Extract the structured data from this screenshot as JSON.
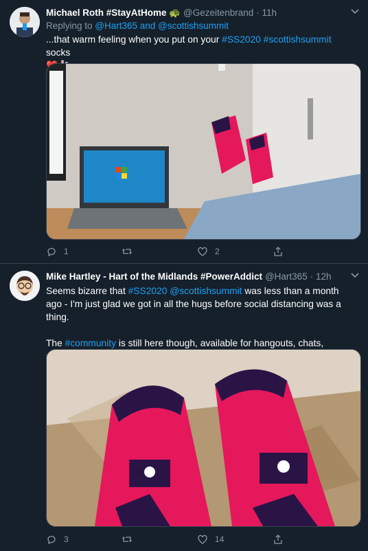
{
  "tweets": [
    {
      "name": "Michael Roth #StayAtHome 🐢",
      "handle": "@Gezeitenbrand",
      "time": "11h",
      "replying_prefix": "Replying to ",
      "replying_to": "@Hart365 and @scottishsummit",
      "text": [
        {
          "t": "...that warm feeling when you put on your ",
          "link": false
        },
        {
          "t": "#SS2020",
          "link": true
        },
        {
          "t": " ",
          "link": false
        },
        {
          "t": "#scottishsummit",
          "link": true
        },
        {
          "t": " socks",
          "link": false
        }
      ],
      "emoji_line": "❤️🧦",
      "counts": {
        "reply": "1",
        "retweet": "",
        "like": "2",
        "share": ""
      },
      "media_alt": "Feet in pink socks on a desk next to a laptop showing Windows 95"
    },
    {
      "name": "Mike Hartley - Hart of the Midlands #PowerAddict",
      "handle": "@Hart365",
      "time": "12h",
      "para1": [
        {
          "t": "Seems bizarre that ",
          "link": false
        },
        {
          "t": "#SS2020",
          "link": true
        },
        {
          "t": " ",
          "link": false
        },
        {
          "t": "@scottishsummit",
          "link": true
        },
        {
          "t": " was less than a month ago - I'm just glad we got in all the hugs before social distancing was a thing.",
          "link": false
        }
      ],
      "para2": [
        {
          "t": "The ",
          "link": false
        },
        {
          "t": "#community",
          "link": true
        },
        {
          "t": " is still here though, available for hangouts, chats, support and more - just message me/us to get connected",
          "link": false
        }
      ],
      "counts": {
        "reply": "3",
        "retweet": "",
        "like": "14",
        "share": ""
      },
      "media_alt": "Two feet in pink and navy socks on a rug"
    }
  ],
  "colors": {
    "background": "#15202b",
    "secondary_text": "#8899a6",
    "link": "#1da1f2",
    "border": "#38444d",
    "sock_pink": "#e5185c",
    "sock_navy": "#2a1446"
  }
}
